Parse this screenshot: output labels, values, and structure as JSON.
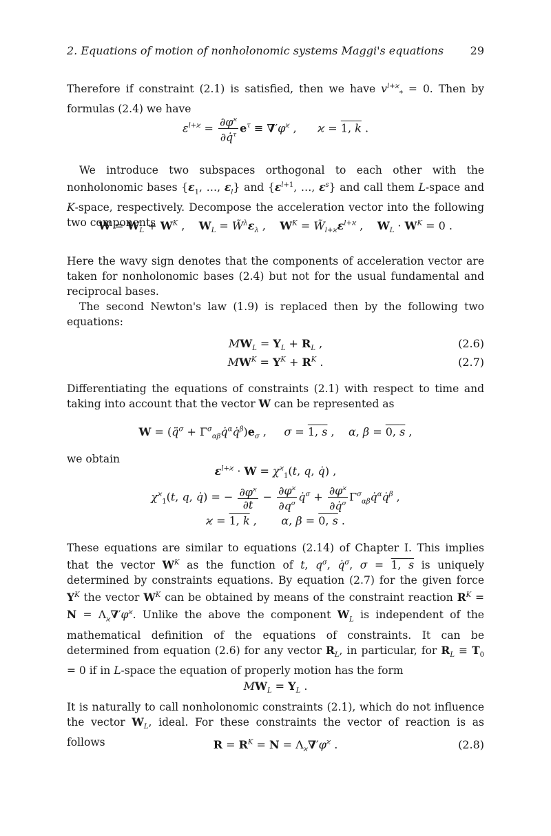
{
  "header": {
    "running_title": "2. Equations of motion of nonholonomic systems Maggi's equations",
    "page_number": "29"
  },
  "paragraphs": {
    "p1": "Therefore if constraint (2.1) is satisfied, then we have v*^(l+ϰ) = 0. Then by formulas (2.4) we have",
    "p2": "We introduce two subspaces orthogonal to each other with the nonholonomic bases {ε1, …, εl} and {ε^(l+1), …, ε^s} and call them L-space and K-space, respectively. Decompose the acceleration vector into the following two components",
    "p3": "Here the wavy sign denotes that the components of acceleration vector are taken for nonholonomic bases (2.4) but not for the usual fundamental and reciprocal bases.",
    "p4": "The second Newton's law (1.9) is replaced then by the following two equations:",
    "p5": "Differentiating the equations of constraints (2.1) with respect to time and taking into account that the vector W can be represented as",
    "p6": "we obtain",
    "p7": "These equations are similar to equations (2.14) of Chapter I. This implies that the vector W^K as the function of t, q^σ, q̇^σ, σ = 1,s is uniquely determined by constraints equations. By equation (2.7) for the given force Y^K the vector W^K can be obtained by means of the constraint reaction R^K = N = Λϰ∇′φ^ϰ. Unlike the above the component W_L is independent of the mathematical definition of the equations of constraints. It can be determined from equation (2.6) for any vector R_L, in particular, for R_L ≡ T0 = 0 if in L-space the equation of properly motion has the form",
    "p8": "It is naturally to call nonholonomic constraints (2.1), which do not influence the vector W_L, ideal. For these constraints the vector of reaction is as follows"
  },
  "equations": {
    "eq_eps": "ε^(l+ϰ) = ∂φ^ϰ/∂q̇^τ e^τ ≡ ∇′φ^ϰ ,   ϰ = 1,k .",
    "eq_decomp": "W = W_L + W^K ,  W_L = W̃^λ ελ ,  W^K = W̃_(l+ϰ) ε^(l+ϰ) ,  W_L · W^K = 0 .",
    "eq_2_6": "MW_L = Y_L + R_L ,",
    "eq_2_6_num": "(2.6)",
    "eq_2_7": "MW^K = Y^K + R^K .",
    "eq_2_7_num": "(2.7)",
    "eq_W": "W = (q̈^σ + Γ^σ_αβ q̇^α q̇^β) e_σ ,   σ = 1,s ,  α, β = 0,s ,",
    "eq_chi1": "ε^(l+ϰ) · W = χ1^ϰ(t, q, q̇) ,",
    "eq_chi2": "χ1^ϰ(t, q, q̇) = −∂φ^ϰ/∂t − ∂φ^ϰ/∂q^σ q̇^σ + ∂φ^ϰ/∂q̇^σ Γ^σ_αβ q̇^α q̇^β ,",
    "eq_chi3": "ϰ = 1,k ,   α, β = 0,s .",
    "eq_motion": "MW_L = Y_L .",
    "eq_2_8": "R = R^K = N = Λϰ ∇′φ^ϰ .",
    "eq_2_8_num": "(2.8)"
  }
}
